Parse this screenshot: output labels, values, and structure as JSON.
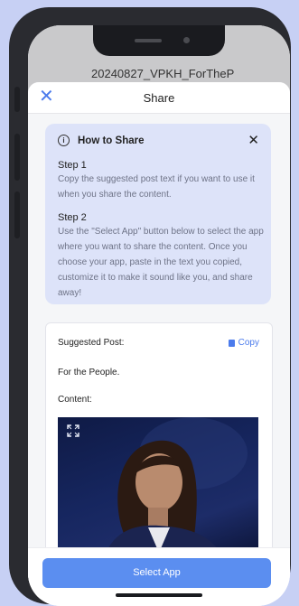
{
  "behind": {
    "title": "20240827_VPKH_ForTheP"
  },
  "header": {
    "close_icon": "close-icon",
    "title": "Share"
  },
  "how_to": {
    "info_icon": "info-icon",
    "title": "How to Share",
    "close_icon": "close-icon",
    "steps": [
      {
        "title": "Step 1",
        "text": "Copy the suggested post text if you want to use it when you share the content."
      },
      {
        "title": "Step 2",
        "text": "Use the \"Select App\" button below to select the app where you want to share the content. Once you choose your app, paste in the text you copied, customize it to make it sound like you, and share away!"
      }
    ]
  },
  "post": {
    "label": "Suggested Post:",
    "copy_icon": "copy-icon",
    "copy_label": "Copy",
    "text": "For the People.",
    "content_label": "Content:",
    "expand_icon": "expand-icon"
  },
  "footer": {
    "select_label": "Select App"
  },
  "colors": {
    "accent": "#5b8ef0",
    "link": "#4b7bec",
    "info_bg": "#dde3f9",
    "page_bg": "#c7d0f4"
  }
}
